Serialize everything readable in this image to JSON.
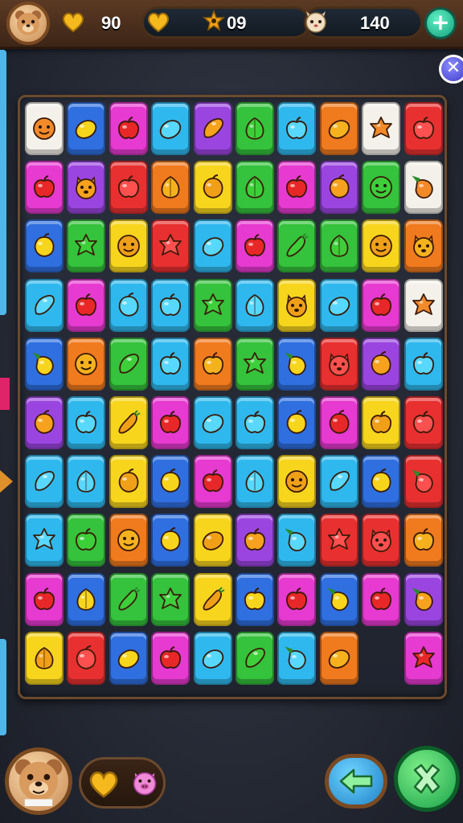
{
  "topbar": {
    "left_value": "90",
    "center_value": "09",
    "right_value": "140",
    "plus_label": "+"
  },
  "close_label": "✕",
  "colors": {
    "W": "#f4f1ea",
    "B": "#2f6fe0",
    "M": "#e63ad0",
    "C": "#2fb8ee",
    "P": "#9b45e0",
    "G": "#35c23c",
    "O": "#f07a1e",
    "R": "#e83030",
    "Y": "#f7d51d"
  },
  "board": {
    "rows": [
      [
        {
          "bg": "W",
          "icon": "face"
        },
        {
          "bg": "B",
          "icon": "lemon"
        },
        {
          "bg": "M",
          "icon": "apple"
        },
        {
          "bg": "C",
          "icon": "lemon"
        },
        {
          "bg": "P",
          "icon": "mango"
        },
        {
          "bg": "G",
          "icon": "leaf"
        },
        {
          "bg": "C",
          "icon": "apple"
        },
        {
          "bg": "O",
          "icon": "lemon"
        },
        {
          "bg": "W",
          "icon": "star"
        },
        {
          "bg": "R",
          "icon": "apple"
        }
      ],
      [
        {
          "bg": "M",
          "icon": "apple"
        },
        {
          "bg": "P",
          "icon": "critter"
        },
        {
          "bg": "R",
          "icon": "apple"
        },
        {
          "bg": "O",
          "icon": "leaf"
        },
        {
          "bg": "Y",
          "icon": "plum"
        },
        {
          "bg": "G",
          "icon": "leaf"
        },
        {
          "bg": "M",
          "icon": "apple"
        },
        {
          "bg": "P",
          "icon": "plum"
        },
        {
          "bg": "G",
          "icon": "face"
        },
        {
          "bg": "W",
          "icon": "pepper"
        }
      ],
      [
        {
          "bg": "B",
          "icon": "plum"
        },
        {
          "bg": "G",
          "icon": "star"
        },
        {
          "bg": "Y",
          "icon": "face"
        },
        {
          "bg": "R",
          "icon": "star"
        },
        {
          "bg": "C",
          "icon": "lemon"
        },
        {
          "bg": "M",
          "icon": "apple"
        },
        {
          "bg": "G",
          "icon": "carrot"
        },
        {
          "bg": "G",
          "icon": "leaf"
        },
        {
          "bg": "Y",
          "icon": "face"
        },
        {
          "bg": "O",
          "icon": "critter"
        }
      ],
      [
        {
          "bg": "C",
          "icon": "mango"
        },
        {
          "bg": "M",
          "icon": "apple"
        },
        {
          "bg": "C",
          "icon": "plum"
        },
        {
          "bg": "C",
          "icon": "apple"
        },
        {
          "bg": "G",
          "icon": "star"
        },
        {
          "bg": "C",
          "icon": "leaf"
        },
        {
          "bg": "Y",
          "icon": "critter"
        },
        {
          "bg": "C",
          "icon": "lemon"
        },
        {
          "bg": "M",
          "icon": "apple"
        },
        {
          "bg": "W",
          "icon": "star"
        }
      ],
      [
        {
          "bg": "B",
          "icon": "pepper"
        },
        {
          "bg": "O",
          "icon": "face"
        },
        {
          "bg": "G",
          "icon": "mango"
        },
        {
          "bg": "C",
          "icon": "apple"
        },
        {
          "bg": "O",
          "icon": "apple"
        },
        {
          "bg": "G",
          "icon": "star"
        },
        {
          "bg": "B",
          "icon": "pepper"
        },
        {
          "bg": "R",
          "icon": "critter"
        },
        {
          "bg": "P",
          "icon": "plum"
        },
        {
          "bg": "C",
          "icon": "apple"
        }
      ],
      [
        {
          "bg": "P",
          "icon": "plum"
        },
        {
          "bg": "C",
          "icon": "apple"
        },
        {
          "bg": "Y",
          "icon": "carrot"
        },
        {
          "bg": "M",
          "icon": "apple"
        },
        {
          "bg": "C",
          "icon": "lemon"
        },
        {
          "bg": "C",
          "icon": "apple"
        },
        {
          "bg": "B",
          "icon": "plum"
        },
        {
          "bg": "M",
          "icon": "plum"
        },
        {
          "bg": "Y",
          "icon": "apple"
        },
        {
          "bg": "R",
          "icon": "apple"
        }
      ],
      [
        {
          "bg": "C",
          "icon": "mango"
        },
        {
          "bg": "C",
          "icon": "leaf"
        },
        {
          "bg": "Y",
          "icon": "plum"
        },
        {
          "bg": "B",
          "icon": "plum"
        },
        {
          "bg": "M",
          "icon": "apple"
        },
        {
          "bg": "C",
          "icon": "leaf"
        },
        {
          "bg": "Y",
          "icon": "face"
        },
        {
          "bg": "C",
          "icon": "mango"
        },
        {
          "bg": "B",
          "icon": "plum"
        },
        {
          "bg": "R",
          "icon": "pepper"
        }
      ],
      [
        {
          "bg": "C",
          "icon": "star"
        },
        {
          "bg": "G",
          "icon": "apple"
        },
        {
          "bg": "O",
          "icon": "face"
        },
        {
          "bg": "B",
          "icon": "plum"
        },
        {
          "bg": "Y",
          "icon": "lemon"
        },
        {
          "bg": "P",
          "icon": "apple"
        },
        {
          "bg": "C",
          "icon": "pepper"
        },
        {
          "bg": "R",
          "icon": "star"
        },
        {
          "bg": "R",
          "icon": "critter"
        },
        {
          "bg": "O",
          "icon": "apple"
        }
      ],
      [
        {
          "bg": "M",
          "icon": "apple"
        },
        {
          "bg": "B",
          "icon": "leaf"
        },
        {
          "bg": "G",
          "icon": "carrot"
        },
        {
          "bg": "G",
          "icon": "star"
        },
        {
          "bg": "Y",
          "icon": "carrot"
        },
        {
          "bg": "B",
          "icon": "apple"
        },
        {
          "bg": "M",
          "icon": "apple"
        },
        {
          "bg": "B",
          "icon": "pepper"
        },
        {
          "bg": "M",
          "icon": "apple"
        },
        {
          "bg": "P",
          "icon": "pepper"
        }
      ],
      [
        {
          "bg": "Y",
          "icon": "leaf"
        },
        {
          "bg": "R",
          "icon": "plum"
        },
        {
          "bg": "B",
          "icon": "lemon"
        },
        {
          "bg": "M",
          "icon": "apple"
        },
        {
          "bg": "C",
          "icon": "lemon"
        },
        {
          "bg": "G",
          "icon": "mango"
        },
        {
          "bg": "C",
          "icon": "pepper"
        },
        {
          "bg": "O",
          "icon": "lemon"
        },
        {
          "bg": "empty",
          "icon": "none"
        },
        {
          "bg": "M",
          "icon": "star"
        }
      ]
    ]
  }
}
